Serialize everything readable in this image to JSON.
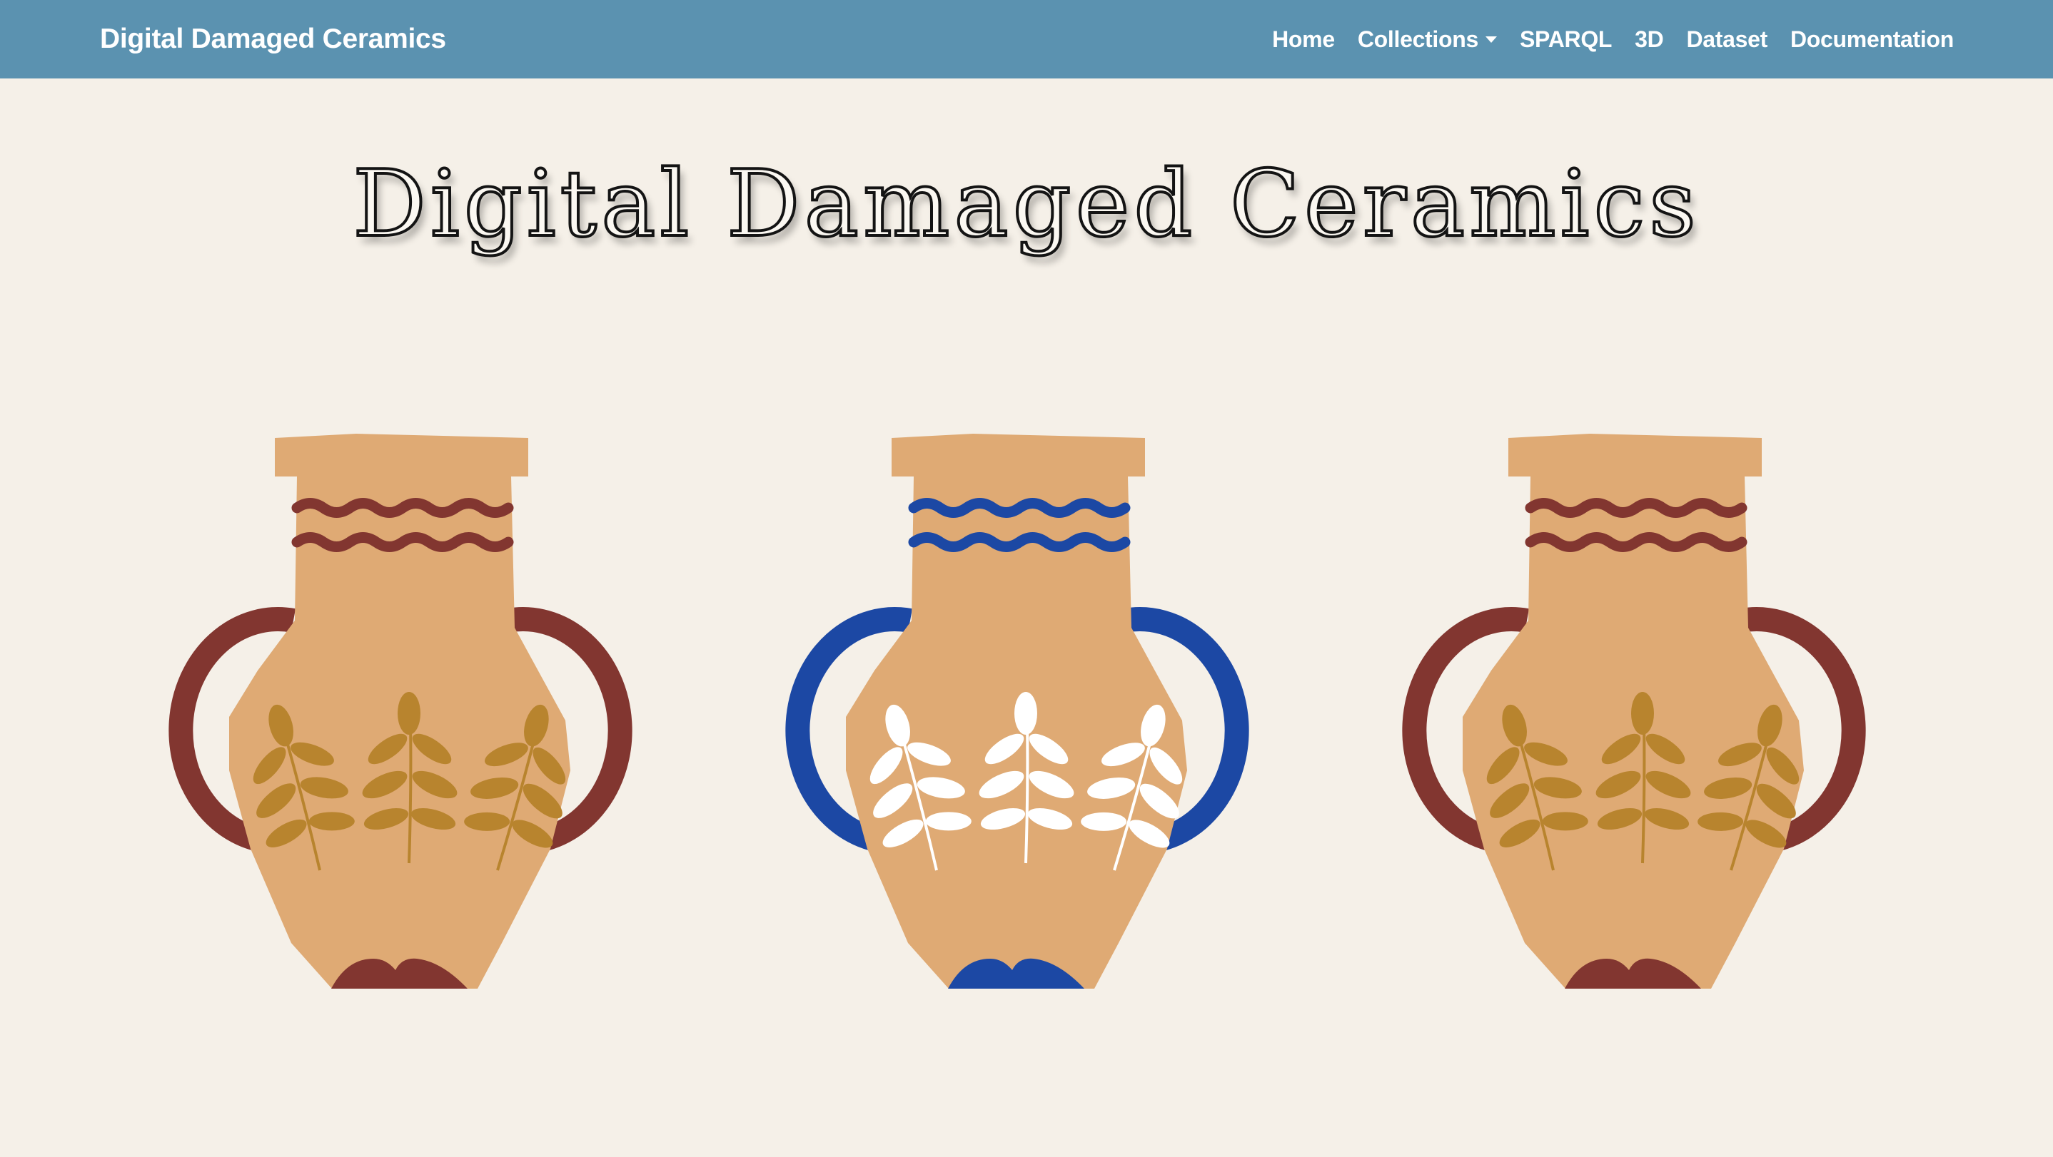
{
  "navbar": {
    "brand": "Digital Damaged Ceramics",
    "items": [
      {
        "label": "Home",
        "has_dropdown": false
      },
      {
        "label": "Collections",
        "has_dropdown": true
      },
      {
        "label": "SPARQL",
        "has_dropdown": false
      },
      {
        "label": "3D",
        "has_dropdown": false
      },
      {
        "label": "Dataset",
        "has_dropdown": false
      },
      {
        "label": "Documentation",
        "has_dropdown": false
      }
    ],
    "background_color": "#5b92b0"
  },
  "hero": {
    "title": "Digital Damaged Ceramics"
  },
  "illustration": {
    "vases": [
      {
        "accent_color": "#823630",
        "leaf_color": "#b8842e",
        "body_color": "#dfaa74"
      },
      {
        "accent_color": "#1c48a4",
        "leaf_color": "#ffffff",
        "body_color": "#dfaa74"
      },
      {
        "accent_color": "#823630",
        "leaf_color": "#b8842e",
        "body_color": "#dfaa74"
      }
    ]
  },
  "colors": {
    "page_background": "#f5f0e8"
  }
}
